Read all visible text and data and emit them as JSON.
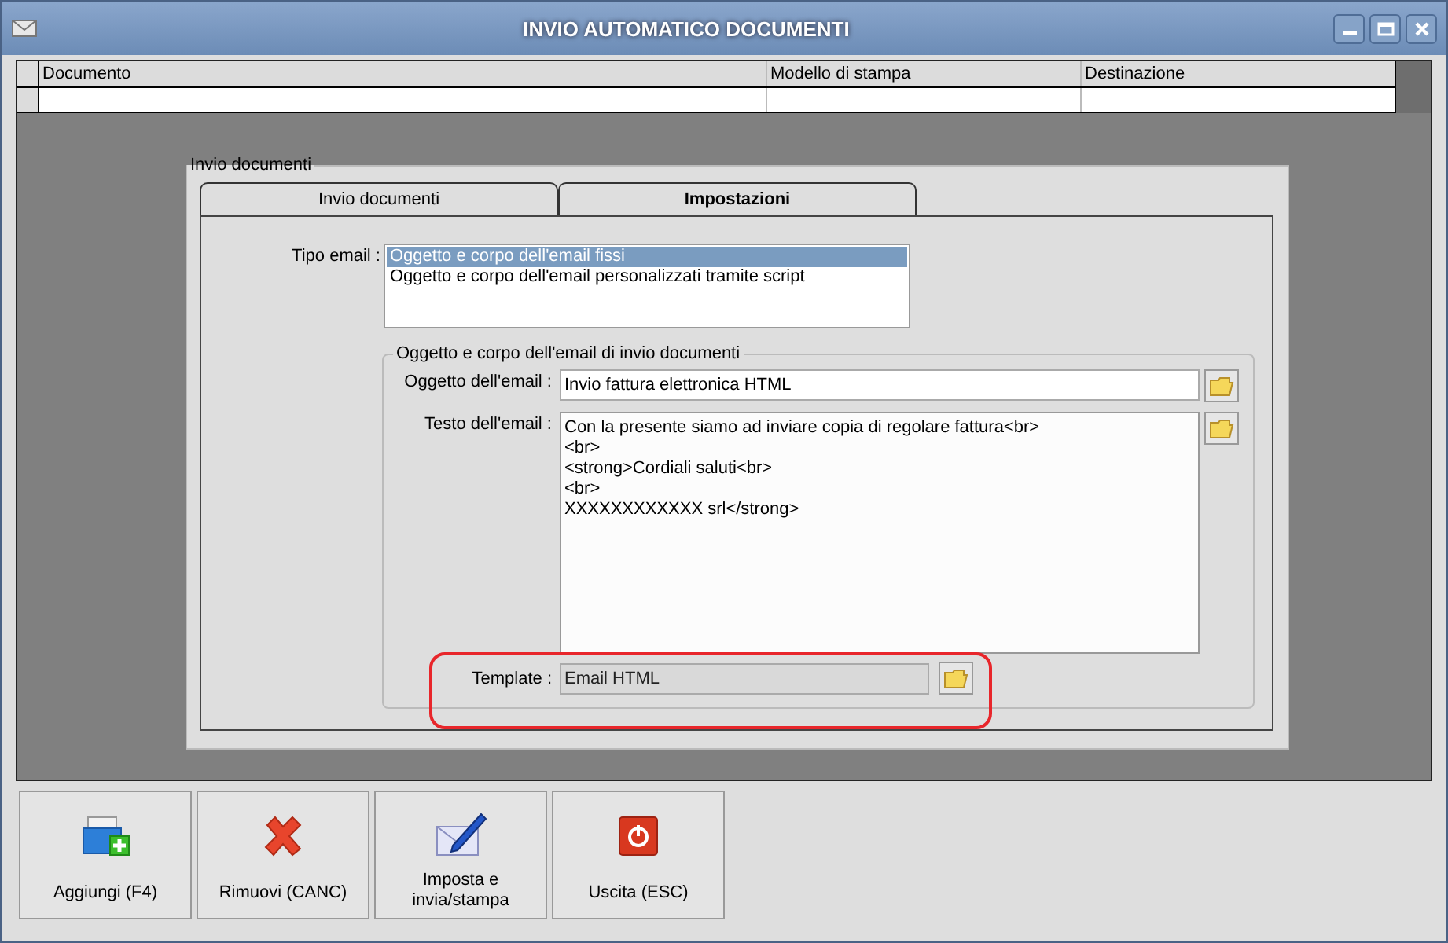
{
  "window": {
    "title": "INVIO AUTOMATICO DOCUMENTI"
  },
  "table": {
    "columns": [
      "Documento",
      "Modello di stampa",
      "Destinazione"
    ]
  },
  "panel": {
    "title": "Invio documenti",
    "tabs": [
      {
        "label": "Invio documenti",
        "selected": false
      },
      {
        "label": "Impostazioni",
        "selected": true
      }
    ]
  },
  "tipo_email": {
    "label": "Tipo email :",
    "options": [
      {
        "label": "Oggetto e corpo dell'email fissi",
        "selected": true
      },
      {
        "label": "Oggetto e corpo dell'email personalizzati tramite script",
        "selected": false
      }
    ]
  },
  "email_group": {
    "title": "Oggetto e corpo dell'email di invio documenti",
    "subject": {
      "label": "Oggetto dell'email :",
      "value": "Invio fattura elettronica HTML"
    },
    "body": {
      "label": "Testo dell'email :",
      "lines": [
        "Con la presente siamo ad inviare copia di regolare fattura<br>",
        "<br>",
        "<strong>Cordiali saluti<br>",
        "<br>",
        "XXXXXXXXXXXX srl</strong>"
      ]
    },
    "template": {
      "label": "Template :",
      "value": "Email HTML",
      "disabled": true,
      "highlighted": true
    }
  },
  "buttons": [
    {
      "label": "Aggiungi (F4)",
      "kind": "add"
    },
    {
      "label": "Rimuovi (CANC)",
      "kind": "remove"
    },
    {
      "label": "Imposta e invia/stampa",
      "kind": "compose"
    },
    {
      "label": "Uscita (ESC)",
      "kind": "exit"
    }
  ]
}
